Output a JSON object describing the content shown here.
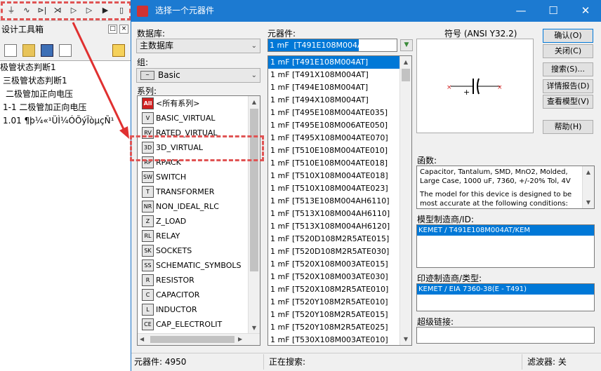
{
  "bg_app": {
    "toolbar_icons": [
      "ground-icon",
      "ac-source-icon",
      "diode-icon",
      "transistor-icon",
      "analog-icon",
      "ttl-icon",
      "cmos-icon",
      "misc-icon"
    ],
    "design_toolbox_title": "设计工具箱",
    "items": [
      "极管状态判断1",
      "三极管状态判断1",
      "二极管加正向电压",
      "1-1 二极管加正向电压",
      "1.01 ¶þ¼«¹ÜÌ¼ÓÕýÏòµçÑ¹"
    ]
  },
  "dialog": {
    "title": "选择一个元器件",
    "database_label": "数据库:",
    "database_value": "主数据库",
    "group_label": "组:",
    "group_value": "Basic",
    "family_label": "系列:",
    "families": [
      {
        "badge": "All",
        "name": "<所有系列>"
      },
      {
        "badge": "V",
        "name": "BASIC_VIRTUAL"
      },
      {
        "badge": "RV",
        "name": "RATED_VIRTUAL"
      },
      {
        "badge": "3D",
        "name": "3D_VIRTUAL"
      },
      {
        "badge": "RP",
        "name": "RPACK"
      },
      {
        "badge": "SW",
        "name": "SWITCH"
      },
      {
        "badge": "T",
        "name": "TRANSFORMER"
      },
      {
        "badge": "NR",
        "name": "NON_IDEAL_RLC"
      },
      {
        "badge": "Z",
        "name": "Z_LOAD"
      },
      {
        "badge": "RL",
        "name": "RELAY"
      },
      {
        "badge": "SK",
        "name": "SOCKETS"
      },
      {
        "badge": "SS",
        "name": "SCHEMATIC_SYMBOLS"
      },
      {
        "badge": "R",
        "name": "RESISTOR"
      },
      {
        "badge": "C",
        "name": "CAPACITOR"
      },
      {
        "badge": "L",
        "name": "INDUCTOR"
      },
      {
        "badge": "CE",
        "name": "CAP_ELECTROLIT"
      }
    ],
    "component_label": "元器件:",
    "component_input": "1 mF  [T491E108M004AT]",
    "components": [
      "1 mF  [T491E108M004AT]",
      "1 mF  [T491X108M004AT]",
      "1 mF  [T494E108M004AT]",
      "1 mF  [T494X108M004AT]",
      "1 mF  [T495E108M004ATE035]",
      "1 mF  [T495E108M006ATE050]",
      "1 mF  [T495X108M004ATE070]",
      "1 mF  [T510E108M004ATE010]",
      "1 mF  [T510E108M004ATE018]",
      "1 mF  [T510X108M004ATE018]",
      "1 mF  [T510X108M004ATE023]",
      "1 mF  [T513E108M004AH6110]",
      "1 mF  [T513X108M004AH6110]",
      "1 mF  [T513X108M004AH6120]",
      "1 mF  [T520D108M2R5ATE015]",
      "1 mF  [T520D108M2R5ATE030]",
      "1 mF  [T520X108M003ATE015]",
      "1 mF  [T520X108M003ATE030]",
      "1 mF  [T520X108M2R5ATE010]",
      "1 mF  [T520Y108M2R5ATE010]",
      "1 mF  [T520Y108M2R5ATE015]",
      "1 mF  [T520Y108M2R5ATE025]",
      "1 mF  [T530X108M003ATE010]"
    ],
    "symbol_label": "符号 (ANSI Y32.2)",
    "buttons": {
      "ok": "确认(O)",
      "close": "关闭(C)",
      "search": "搜索(S)...",
      "detail": "详情报告(D)",
      "model": "查看模型(V)",
      "help": "帮助(H)"
    },
    "function_label": "函数:",
    "function_text": "Capacitor, Tantalum, SMD, MnO2, Molded, Large Case, 1000 uF, 7360, +/-20% Tol, 4V",
    "function_text2": "The model for this device is designed to be most accurate at the following conditions:",
    "model_maker_label": "模型制造商/ID:",
    "model_maker_value": "KEMET / T491E108M004AT/KEM",
    "footprint_label": "印迹制造商/类型:",
    "footprint_value": "KEMET / EIA 7360-38(E - T491)",
    "hyperlink_label": "超级链接:",
    "status_count": "元器件: 4950",
    "status_search": "正在搜索:",
    "status_filter": "滤波器: 关"
  }
}
